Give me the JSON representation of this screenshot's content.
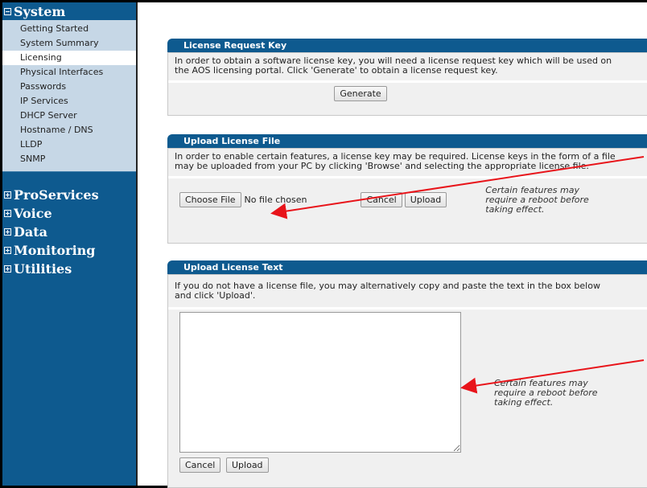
{
  "sidebar": {
    "system_label": "System",
    "system_items": [
      {
        "label": "Getting Started"
      },
      {
        "label": "System Summary"
      },
      {
        "label": "Licensing"
      },
      {
        "label": "Physical Interfaces"
      },
      {
        "label": "Passwords"
      },
      {
        "label": "IP Services"
      },
      {
        "label": "DHCP Server"
      },
      {
        "label": "Hostname / DNS"
      },
      {
        "label": "LLDP"
      },
      {
        "label": "SNMP"
      }
    ],
    "groups": [
      {
        "label": "ProServices"
      },
      {
        "label": "Voice"
      },
      {
        "label": "Data"
      },
      {
        "label": "Monitoring"
      },
      {
        "label": "Utilities"
      }
    ]
  },
  "request_key": {
    "title": "License Request Key",
    "text": "In order to obtain a software license key, you will need a license request key which will be used on the AOS licensing portal. Click 'Generate' to obtain a license request key.",
    "generate_label": "Generate"
  },
  "upload_file": {
    "title": "Upload License File",
    "text": "In order to enable certain features, a license key may be required. License keys in the form of a file may be uploaded from your PC by clicking 'Browse' and selecting the appropriate license file.",
    "choose_label": "Choose File",
    "file_status": "No file chosen",
    "cancel_label": "Cancel",
    "upload_label": "Upload",
    "note": "Certain features may require a reboot before taking effect."
  },
  "upload_text": {
    "title": "Upload License Text",
    "text": "If you do not have a license file, you may alternatively copy and paste the text in the box below and click 'Upload'.",
    "textarea_value": "",
    "note": "Certain features may require a reboot before taking effect.",
    "cancel_label": "Cancel",
    "upload_label": "Upload"
  },
  "colors": {
    "sidebar": "#0e5a8f",
    "sidebar_items_bg": "#c6d7e6",
    "panel_title": "#0e5a8f",
    "annotation_arrow": "#e8141a"
  }
}
